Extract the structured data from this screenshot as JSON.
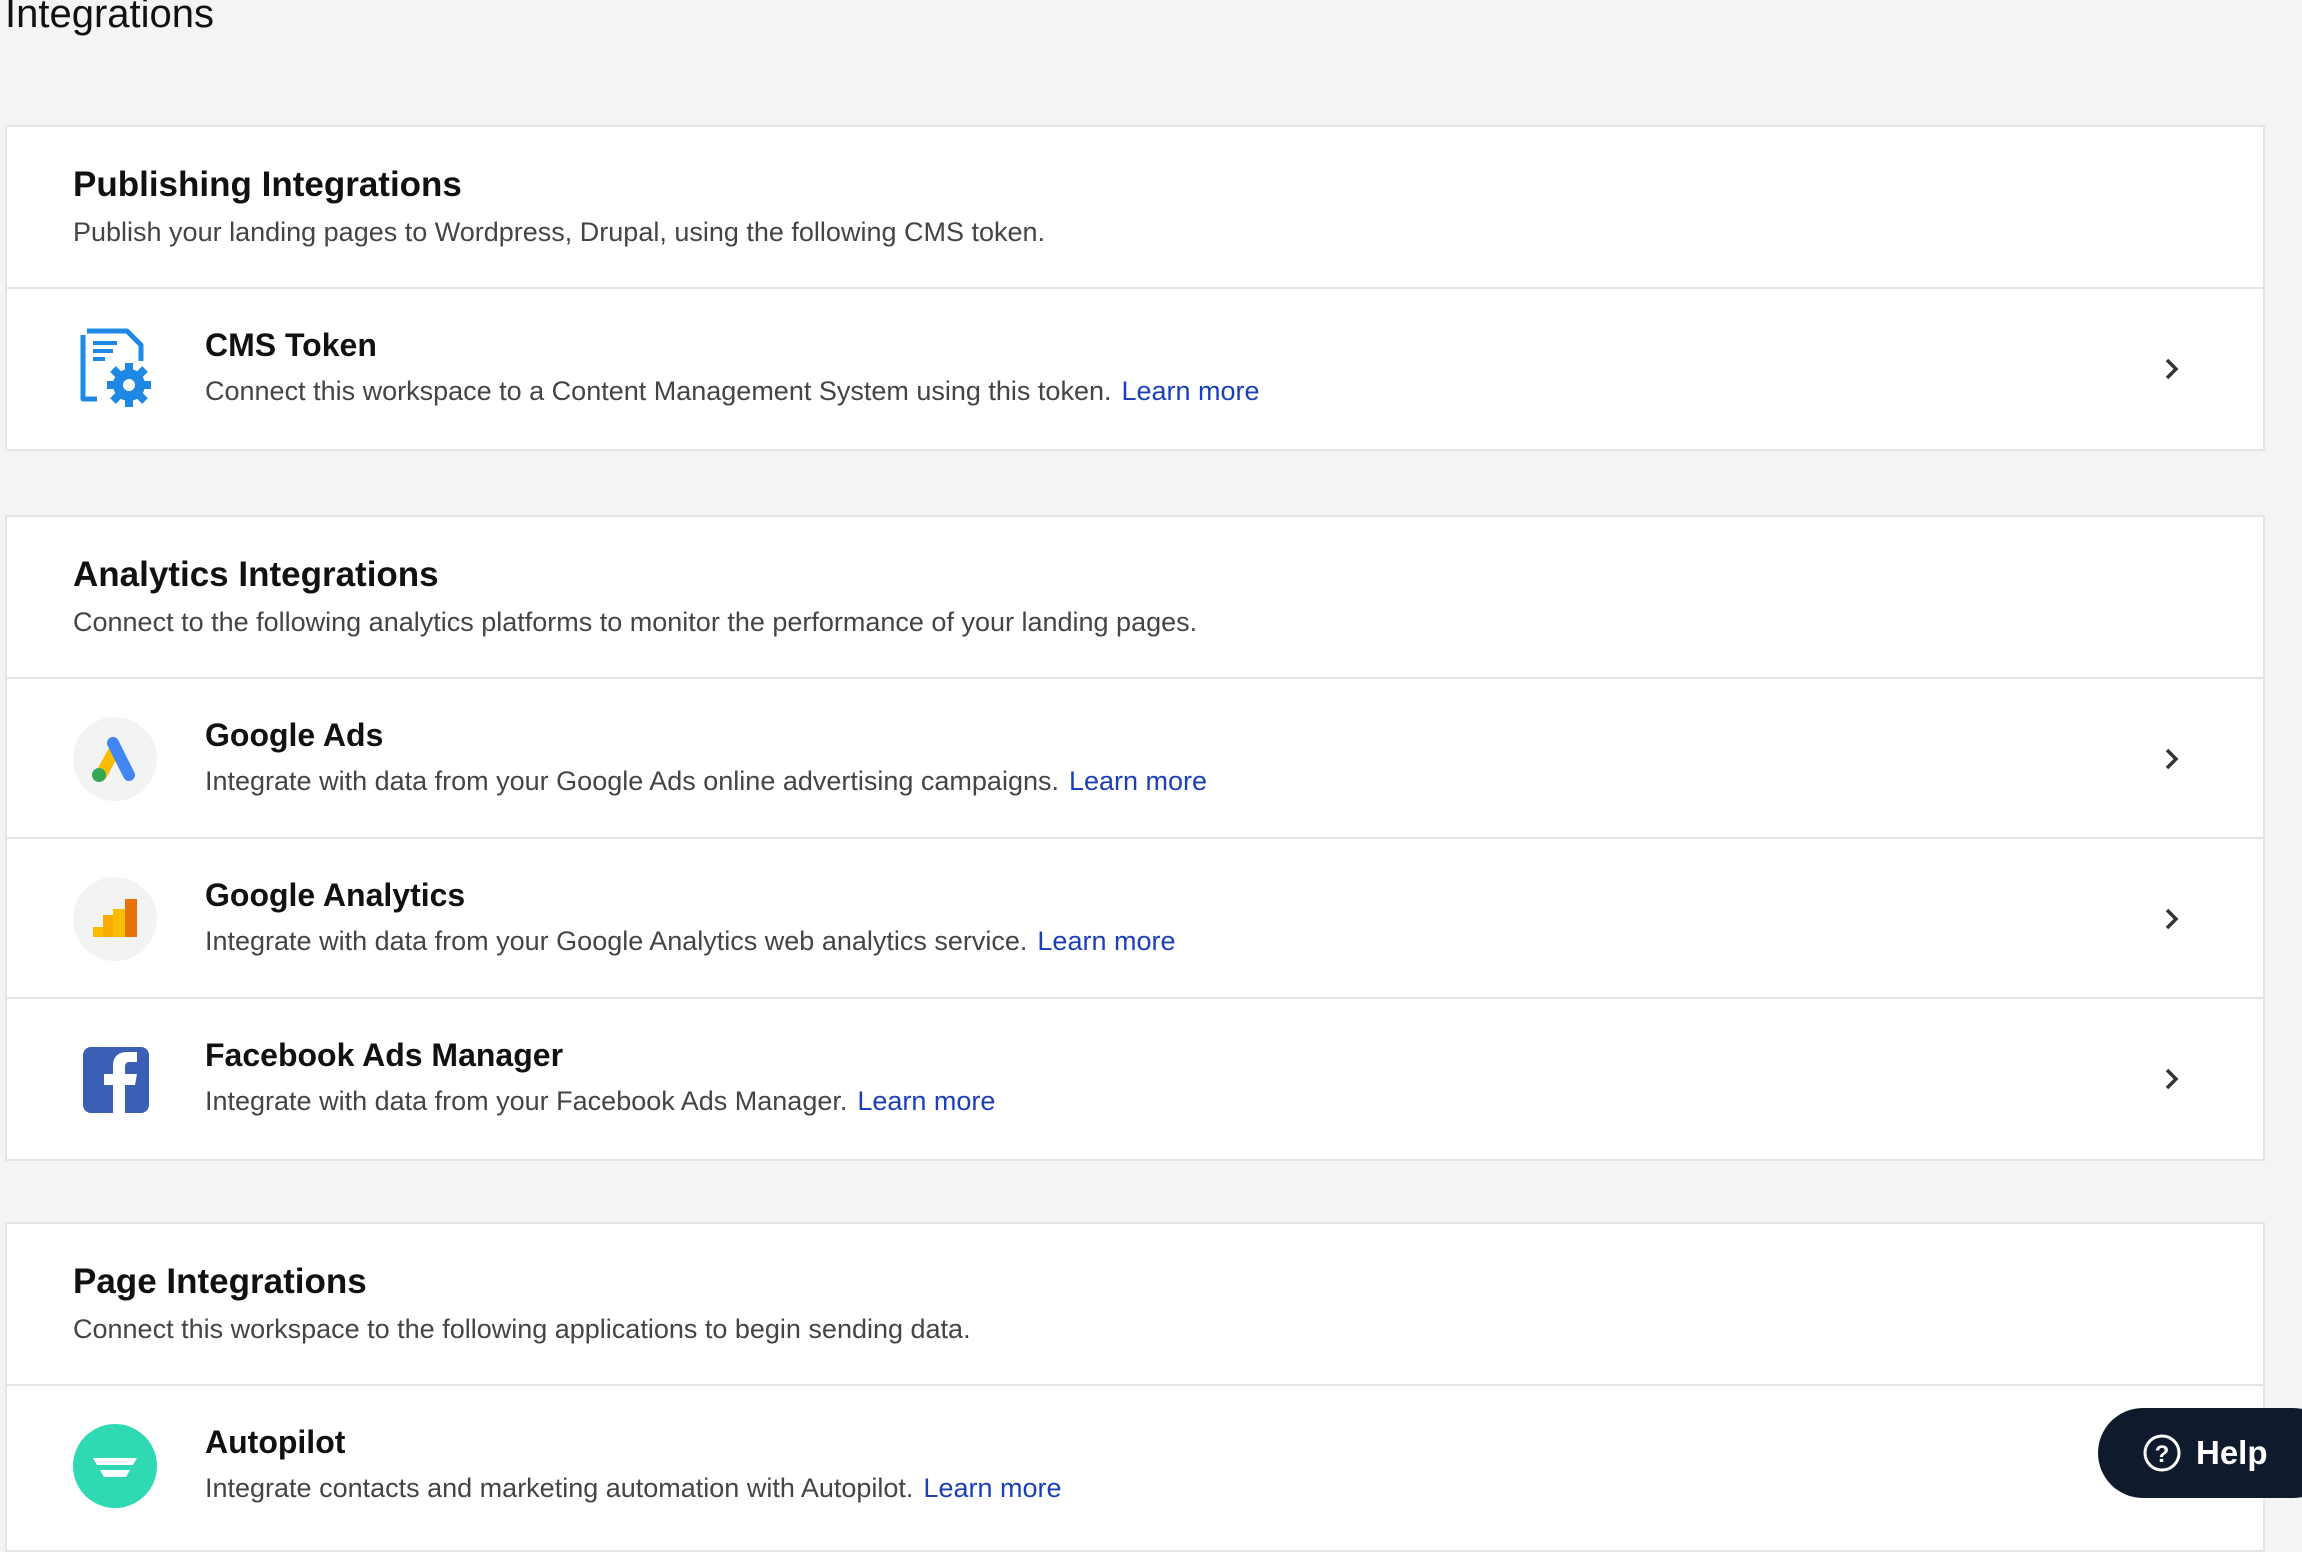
{
  "page_title": "Integrations",
  "sections": [
    {
      "title": "Publishing Integrations",
      "description": "Publish your landing pages to Wordpress, Drupal, using the following CMS token.",
      "items": [
        {
          "name": "CMS Token",
          "description": "Connect this workspace to a Content Management System using this token.",
          "link": "Learn more",
          "icon": "cms-token-icon"
        }
      ]
    },
    {
      "title": "Analytics Integrations",
      "description": "Connect to the following analytics platforms to monitor the performance of your landing pages.",
      "items": [
        {
          "name": "Google Ads",
          "description": "Integrate with data from your Google Ads online advertising campaigns.",
          "link": "Learn more",
          "icon": "google-ads-icon"
        },
        {
          "name": "Google Analytics",
          "description": "Integrate with data from your Google Analytics web analytics service.",
          "link": "Learn more",
          "icon": "google-analytics-icon"
        },
        {
          "name": "Facebook Ads Manager",
          "description": "Integrate with data from your Facebook Ads Manager.",
          "link": "Learn more",
          "icon": "facebook-icon"
        }
      ]
    },
    {
      "title": "Page Integrations",
      "description": "Connect this workspace to the following applications to begin sending data.",
      "items": [
        {
          "name": "Autopilot",
          "description": "Integrate contacts and marketing automation with Autopilot.",
          "link": "Learn more",
          "icon": "autopilot-icon"
        }
      ]
    }
  ],
  "help_label": "Help",
  "colors": {
    "link": "#1a3fb8",
    "help_bg": "#0f1b2d",
    "cms_blue": "#1e88e5"
  }
}
